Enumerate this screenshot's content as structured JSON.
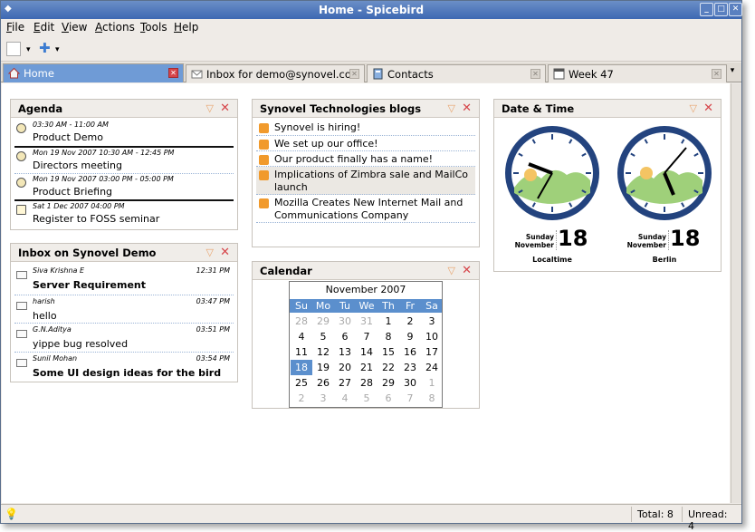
{
  "window": {
    "title": "Home - Spicebird"
  },
  "menu": [
    {
      "label": "File",
      "accel": "F",
      "rest": "ile"
    },
    {
      "label": "Edit",
      "accel": "E",
      "rest": "dit"
    },
    {
      "label": "View",
      "accel": "V",
      "rest": "iew"
    },
    {
      "label": "Actions",
      "accel": "A",
      "rest": "ctions"
    },
    {
      "label": "Tools",
      "accel": "T",
      "rest": "ools"
    },
    {
      "label": "Help",
      "accel": "H",
      "rest": "elp"
    }
  ],
  "tabs": [
    {
      "label": "Home",
      "icon": "home-icon",
      "active": true
    },
    {
      "label": "Inbox for demo@synovel.com",
      "icon": "mail-icon",
      "active": false
    },
    {
      "label": "Contacts",
      "icon": "contacts-icon",
      "active": false
    },
    {
      "label": "Week 47",
      "icon": "calendar-icon",
      "active": false
    }
  ],
  "agenda": {
    "title": "Agenda",
    "items": [
      {
        "time": "03:30 AM - 11:00 AM",
        "title": "Product Demo",
        "icon": "event-icon"
      },
      {
        "time": "Mon 19 Nov 2007 10:30 AM - 12:45 PM",
        "title": "Directors meeting",
        "icon": "event-icon"
      },
      {
        "time": "Mon 19 Nov 2007 03:00 PM - 05:00 PM",
        "title": "Product Briefing",
        "icon": "event-icon"
      },
      {
        "time": "Sat 1 Dec 2007 04:00 PM",
        "title": "Register to FOSS seminar",
        "icon": "task-icon"
      }
    ]
  },
  "inbox": {
    "title": "Inbox on Synovel Demo",
    "items": [
      {
        "from": "Siva Krishna E",
        "time": "12:31 PM",
        "subject": "Server Requirement",
        "unread": true
      },
      {
        "from": "harish",
        "time": "03:47 PM",
        "subject": "hello",
        "unread": false
      },
      {
        "from": "G.N.Aditya",
        "time": "03:51 PM",
        "subject": "yippe bug resolved",
        "unread": false
      },
      {
        "from": "Sunil Mohan",
        "time": "03:54 PM",
        "subject": "Some UI design ideas for the bird",
        "unread": true
      }
    ]
  },
  "blogs": {
    "title": "Synovel Technologies blogs",
    "items": [
      "Synovel is hiring!",
      "We set up our office!",
      "Our product finally has a name!",
      "Implications of Zimbra sale and MailCo launch",
      "Mozilla Creates New Internet Mail and Communications Company"
    ]
  },
  "calendar": {
    "title": "Calendar",
    "month_label": "November  2007",
    "weekdays": [
      "Su",
      "Mo",
      "Tu",
      "We",
      "Th",
      "Fr",
      "Sa"
    ],
    "weeks": [
      [
        "28",
        "29",
        "30",
        "31",
        "1",
        "2",
        "3"
      ],
      [
        "4",
        "5",
        "6",
        "7",
        "8",
        "9",
        "10"
      ],
      [
        "11",
        "12",
        "13",
        "14",
        "15",
        "16",
        "17"
      ],
      [
        "18",
        "19",
        "20",
        "21",
        "22",
        "23",
        "24"
      ],
      [
        "25",
        "26",
        "27",
        "28",
        "29",
        "30",
        "1"
      ],
      [
        "2",
        "3",
        "4",
        "5",
        "6",
        "7",
        "8"
      ]
    ],
    "today": "18"
  },
  "datetime": {
    "title": "Date & Time",
    "clocks": [
      {
        "weekday": "Sunday",
        "month": "November",
        "day": "18",
        "city": "Localtime"
      },
      {
        "weekday": "Sunday",
        "month": "November",
        "day": "18",
        "city": "Berlin"
      }
    ]
  },
  "status": {
    "total": "Total: 8",
    "unread": "Unread: 4"
  }
}
